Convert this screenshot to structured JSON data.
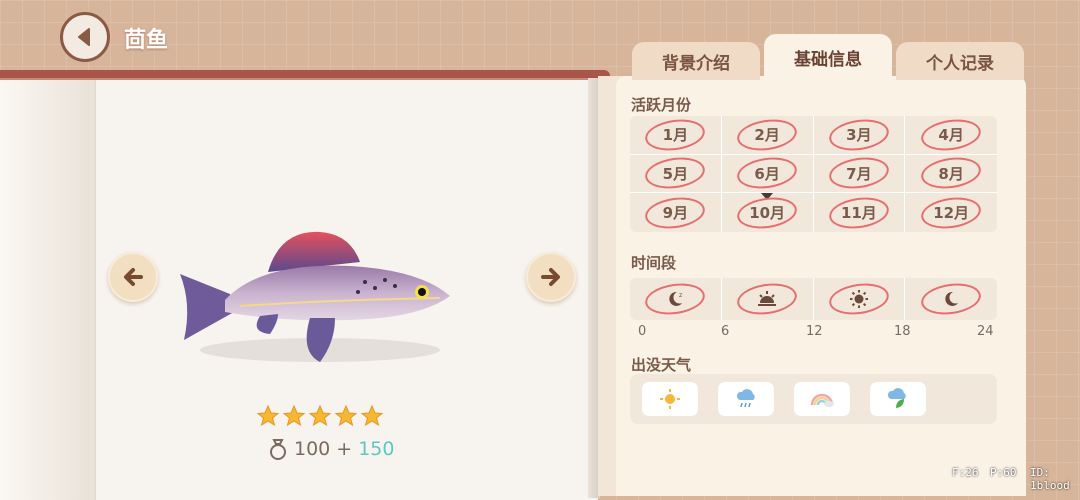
{
  "header": {
    "title": "茴鱼"
  },
  "tabs": [
    {
      "label": "背景介绍"
    },
    {
      "label": "基础信息"
    },
    {
      "label": "个人记录"
    }
  ],
  "months": {
    "label": "活跃月份",
    "items": [
      "1月",
      "2月",
      "3月",
      "4月",
      "5月",
      "6月",
      "7月",
      "8月",
      "9月",
      "10月",
      "11月",
      "12月"
    ],
    "current_month": "10月"
  },
  "time_period": {
    "label": "时间段",
    "ticks": [
      "0",
      "6",
      "12",
      "18",
      "24"
    ],
    "slots": [
      {
        "icon": "moon-sleep-icon"
      },
      {
        "icon": "sunrise-icon"
      },
      {
        "icon": "sun-icon"
      },
      {
        "icon": "moon-icon"
      }
    ]
  },
  "weather": {
    "label": "出没天气",
    "items": [
      {
        "icon": "sunny-icon"
      },
      {
        "icon": "rain-icon"
      },
      {
        "icon": "rainbow-icon"
      },
      {
        "icon": "leaf-rain-icon"
      }
    ]
  },
  "fish": {
    "rating": 5,
    "price_base": "100",
    "price_plus": "+",
    "price_bonus": "150"
  },
  "hud": {
    "left": "F:26",
    "mid": "P:60",
    "right": "ID: 1blood"
  },
  "colors": {
    "accent": "#e86d6d",
    "bonus": "#5fc6c0",
    "star": "#f7b733"
  }
}
